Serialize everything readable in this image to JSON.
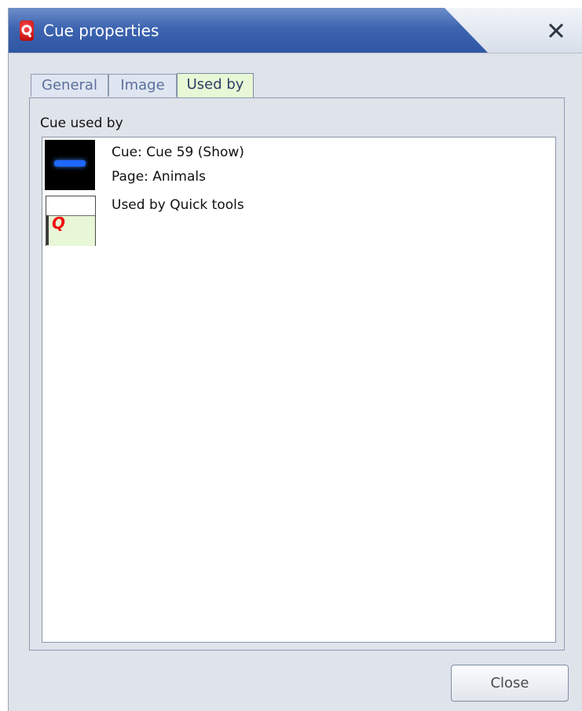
{
  "window": {
    "title": "Cue properties"
  },
  "tabs": [
    {
      "label": "General"
    },
    {
      "label": "Image"
    },
    {
      "label": "Used by",
      "active": true
    }
  ],
  "group": {
    "label": "Cue used by"
  },
  "entries": [
    {
      "icon": "cue-thumbnail",
      "lines": [
        "Cue: Cue 59 (Show)",
        "Page: Animals"
      ]
    },
    {
      "icon": "quick-tools-icon",
      "lines": [
        "Used by Quick tools"
      ],
      "icon_glyph": "Q"
    }
  ],
  "buttons": {
    "close_label": "Close"
  },
  "colors": {
    "title_bar": "#3d64b0",
    "active_tab": "#e8f7d6",
    "logo": "#cc0000",
    "quick_q": "#ee1111"
  }
}
